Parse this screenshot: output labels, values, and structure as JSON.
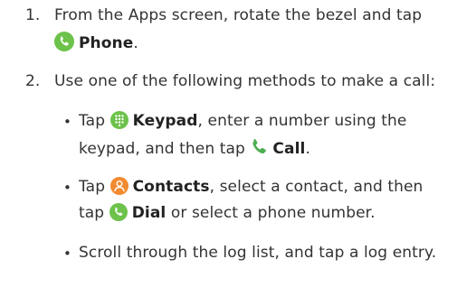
{
  "steps": [
    {
      "number": "1.",
      "line1_text": "From the Apps screen, rotate the bezel and tap",
      "line2_bold": "Phone",
      "line2_after": ".",
      "icon": "phone-icon"
    },
    {
      "number": "2.",
      "text": "Use one of the following methods to make a call:",
      "bullets": [
        {
          "marker": "•",
          "line1_before": "Tap",
          "line1_icon": "keypad-icon",
          "line1_bold": "Keypad",
          "line1_after": ", enter a number using the",
          "line2_before": "keypad, and then tap",
          "line2_icon": "call-handset-icon",
          "line2_bold": "Call",
          "line2_after": "."
        },
        {
          "marker": "•",
          "line1_before": "Tap",
          "line1_icon": "contacts-icon",
          "line1_bold": "Contacts",
          "line1_after": ", select a contact, and then",
          "line2_before": "tap",
          "line2_icon": "dial-icon",
          "line2_bold": "Dial",
          "line2_after": " or select a phone number."
        },
        {
          "marker": "•",
          "text": "Scroll through the log list, and tap a log entry."
        }
      ]
    }
  ],
  "colors": {
    "text": "#333333",
    "phone_icon": "#6cc24a",
    "keypad_icon": "#6cc24a",
    "call_icon": "#4caf50",
    "contacts_icon": "#f28a30",
    "dial_icon": "#6cc24a"
  }
}
